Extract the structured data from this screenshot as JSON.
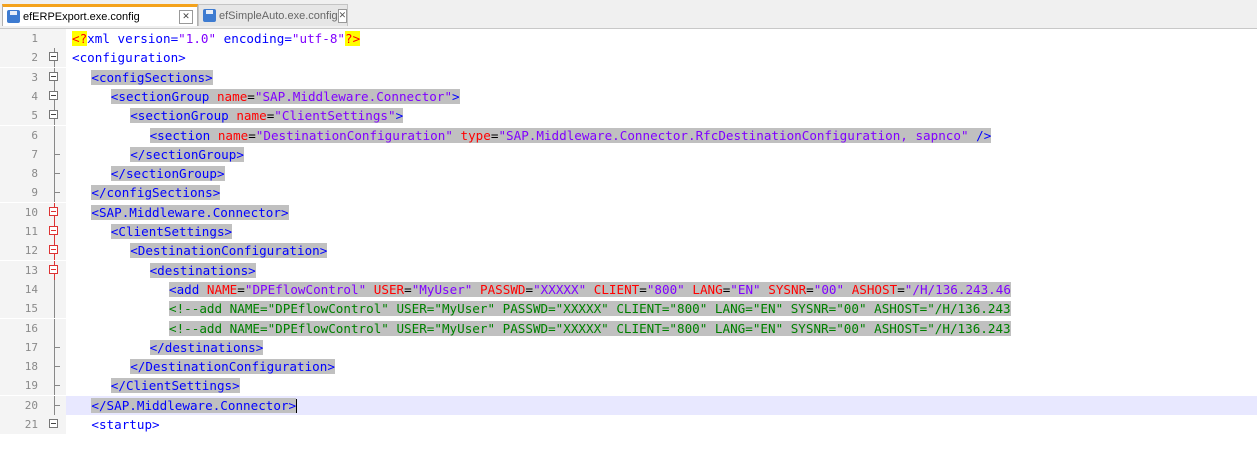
{
  "tabs": [
    {
      "label": "efERPExport.exe.config",
      "close": "✕"
    },
    {
      "label": "efSimpleAuto.exe.config",
      "close": "✕"
    }
  ],
  "lines": [
    {
      "num": "1",
      "fold": null,
      "indent": 0,
      "segments": [
        {
          "t": "pi",
          "v": "<?"
        },
        {
          "t": "pibody",
          "v": "xml version="
        },
        {
          "t": "val",
          "v": "\"1.0\""
        },
        {
          "t": "pibody",
          "v": " encoding="
        },
        {
          "t": "val",
          "v": "\"utf-8\""
        },
        {
          "t": "pi",
          "v": "?>"
        }
      ]
    },
    {
      "num": "2",
      "fold": "box",
      "indent": 0,
      "segments": [
        {
          "t": "tag",
          "v": "<configuration>"
        }
      ]
    },
    {
      "num": "3",
      "fold": "box",
      "indent": 1,
      "segments": [
        {
          "t": "tag",
          "v": "<configSections>"
        }
      ]
    },
    {
      "num": "4",
      "fold": "box",
      "indent": 2,
      "segments": [
        {
          "t": "tag",
          "v": "<sectionGroup "
        },
        {
          "t": "attr",
          "v": "name"
        },
        {
          "t": "plain",
          "v": "="
        },
        {
          "t": "val",
          "v": "\"SAP.Middleware.Connector\""
        },
        {
          "t": "tag",
          "v": ">"
        }
      ]
    },
    {
      "num": "5",
      "fold": "box",
      "indent": 3,
      "segments": [
        {
          "t": "tag",
          "v": "<sectionGroup "
        },
        {
          "t": "attr",
          "v": "name"
        },
        {
          "t": "plain",
          "v": "="
        },
        {
          "t": "val",
          "v": "\"ClientSettings\""
        },
        {
          "t": "tag",
          "v": ">"
        }
      ]
    },
    {
      "num": "6",
      "fold": "line",
      "indent": 4,
      "segments": [
        {
          "t": "tag",
          "v": "<section "
        },
        {
          "t": "attr",
          "v": "name"
        },
        {
          "t": "plain",
          "v": "="
        },
        {
          "t": "val",
          "v": "\"DestinationConfiguration\""
        },
        {
          "t": "plain",
          "v": " "
        },
        {
          "t": "attr",
          "v": "type"
        },
        {
          "t": "plain",
          "v": "="
        },
        {
          "t": "val",
          "v": "\"SAP.Middleware.Connector.RfcDestinationConfiguration, sapnco\""
        },
        {
          "t": "tag",
          "v": " />"
        }
      ]
    },
    {
      "num": "7",
      "fold": "end",
      "indent": 3,
      "segments": [
        {
          "t": "tag",
          "v": "</sectionGroup>"
        }
      ]
    },
    {
      "num": "8",
      "fold": "end",
      "indent": 2,
      "segments": [
        {
          "t": "tag",
          "v": "</sectionGroup>"
        }
      ]
    },
    {
      "num": "9",
      "fold": "end",
      "indent": 1,
      "segments": [
        {
          "t": "tag",
          "v": "</configSections>"
        }
      ]
    },
    {
      "num": "10",
      "fold": "redbox",
      "indent": 1,
      "segments": [
        {
          "t": "tag",
          "v": "<SAP.Middleware.Connector>"
        }
      ]
    },
    {
      "num": "11",
      "fold": "redbox",
      "indent": 2,
      "segments": [
        {
          "t": "tag",
          "v": "<ClientSettings>"
        }
      ]
    },
    {
      "num": "12",
      "fold": "redbox",
      "indent": 3,
      "segments": [
        {
          "t": "tag",
          "v": "<DestinationConfiguration>"
        }
      ]
    },
    {
      "num": "13",
      "fold": "redbox",
      "indent": 4,
      "segments": [
        {
          "t": "tag",
          "v": "<destinations>"
        }
      ]
    },
    {
      "num": "14",
      "fold": "line",
      "indent": 5,
      "segments": [
        {
          "t": "tag",
          "v": "<add "
        },
        {
          "t": "attr",
          "v": "NAME"
        },
        {
          "t": "plain",
          "v": "="
        },
        {
          "t": "val",
          "v": "\"DPEflowControl\""
        },
        {
          "t": "plain",
          "v": " "
        },
        {
          "t": "attr",
          "v": "USER"
        },
        {
          "t": "plain",
          "v": "="
        },
        {
          "t": "val",
          "v": "\"MyUser\""
        },
        {
          "t": "plain",
          "v": " "
        },
        {
          "t": "attr",
          "v": "PASSWD"
        },
        {
          "t": "plain",
          "v": "="
        },
        {
          "t": "val",
          "v": "\"XXXXX\""
        },
        {
          "t": "plain",
          "v": " "
        },
        {
          "t": "attr",
          "v": "CLIENT"
        },
        {
          "t": "plain",
          "v": "="
        },
        {
          "t": "val",
          "v": "\"800\""
        },
        {
          "t": "plain",
          "v": " "
        },
        {
          "t": "attr",
          "v": "LANG"
        },
        {
          "t": "plain",
          "v": "="
        },
        {
          "t": "val",
          "v": "\"EN\""
        },
        {
          "t": "plain",
          "v": " "
        },
        {
          "t": "attr",
          "v": "SYSNR"
        },
        {
          "t": "plain",
          "v": "="
        },
        {
          "t": "val",
          "v": "\"00\""
        },
        {
          "t": "plain",
          "v": " "
        },
        {
          "t": "attr",
          "v": "ASHOST"
        },
        {
          "t": "plain",
          "v": "="
        },
        {
          "t": "val",
          "v": "\"/H/136.243.46"
        }
      ]
    },
    {
      "num": "15",
      "fold": "line",
      "indent": 5,
      "segments": [
        {
          "t": "com",
          "v": "<!--add NAME=\"DPEflowControl\" USER=\"MyUser\" PASSWD=\"XXXXX\" CLIENT=\"800\" LANG=\"EN\" SYSNR=\"00\" ASHOST=\"/H/136.243"
        }
      ]
    },
    {
      "num": "16",
      "fold": "line",
      "indent": 5,
      "segments": [
        {
          "t": "com",
          "v": "<!--add NAME=\"DPEflowControl\" USER=\"MyUser\" PASSWD=\"XXXXX\" CLIENT=\"800\" LANG=\"EN\" SYSNR=\"00\" ASHOST=\"/H/136.243"
        }
      ]
    },
    {
      "num": "17",
      "fold": "end",
      "indent": 4,
      "segments": [
        {
          "t": "tag",
          "v": "</destinations>"
        }
      ]
    },
    {
      "num": "18",
      "fold": "end",
      "indent": 3,
      "segments": [
        {
          "t": "tag",
          "v": "</DestinationConfiguration>"
        }
      ]
    },
    {
      "num": "19",
      "fold": "end",
      "indent": 2,
      "segments": [
        {
          "t": "tag",
          "v": "</ClientSettings>"
        }
      ]
    },
    {
      "num": "20",
      "fold": "end",
      "indent": 1,
      "current": true,
      "segments": [
        {
          "t": "tag",
          "v": "</SAP.Middleware.Connector>"
        }
      ]
    },
    {
      "num": "21",
      "fold": "box",
      "indent": 1,
      "segments": [
        {
          "t": "tag",
          "v": "<startup>"
        }
      ]
    }
  ]
}
